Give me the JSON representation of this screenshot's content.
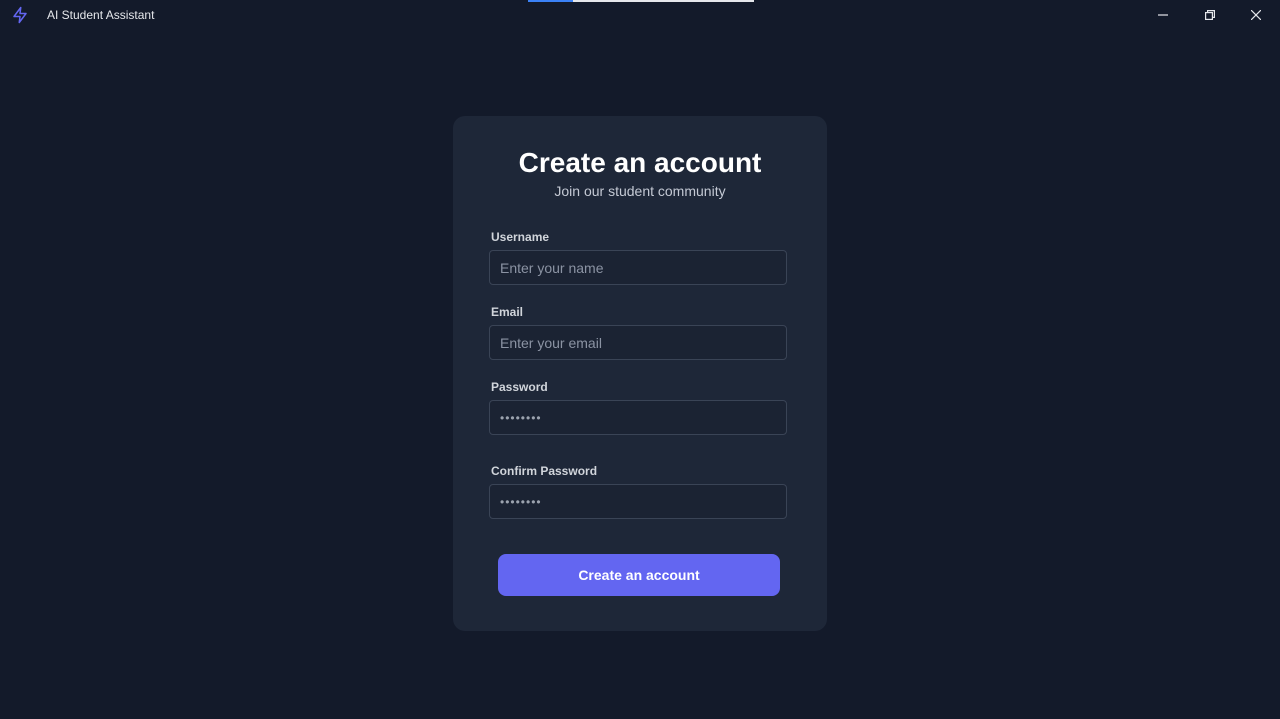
{
  "window": {
    "title": "AI Student Assistant",
    "icon": "lightning-icon",
    "accent": "#6366f1",
    "loading_progress": 0.2,
    "controls": {
      "minimize": "minimize-icon",
      "maximize": "restore-icon",
      "close": "close-icon"
    }
  },
  "form": {
    "title": "Create an account",
    "subtitle": "Join our student community",
    "fields": [
      {
        "label": "Username",
        "placeholder": "Enter your name",
        "value": "",
        "type": "text"
      },
      {
        "label": "Email",
        "placeholder": "Enter your email",
        "value": "",
        "type": "email"
      },
      {
        "label": "Password",
        "placeholder": "",
        "value": "••••••••",
        "type": "password"
      },
      {
        "label": "Confirm Password",
        "placeholder": "",
        "value": "••••••••",
        "type": "password"
      }
    ],
    "submit_label": "Create an account"
  },
  "colors": {
    "background": "#131a2a",
    "card": "#1e2738",
    "button": "#6366f1"
  }
}
